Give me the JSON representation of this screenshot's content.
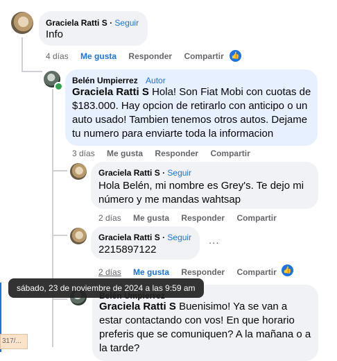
{
  "comments": [
    {
      "author": "Graciela Ratti S",
      "follow": "Seguir",
      "text": "Info",
      "time": "4 días",
      "like": "Me gusta",
      "reply": "Responder",
      "share": "Compartir"
    },
    {
      "author": "Belén Umpierrez",
      "badge": "Autor",
      "tag": "Graciela Ratti S",
      "text": "Hola! Son Fiat Mobi con cuotas de $183.000. Hay opcion de retirarlo con anticipo o un auto usado! Tambien tenemos otros autos. Dejame tu numero para enviarte toda la informacion",
      "time": "3 días",
      "like": "Me gusta",
      "reply": "Responder",
      "share": "Compartir"
    },
    {
      "author": "Graciela Ratti S",
      "follow": "Seguir",
      "text": "Hola Belén, mi nombre es Grey's. Te dejo mi número y me mandas wahtsap",
      "time": "2 días",
      "like": "Me gusta",
      "reply": "Responder",
      "share": "Compartir"
    },
    {
      "author": "Graciela Ratti S",
      "follow": "Seguir",
      "text": "2215897122",
      "time": "2 días",
      "like": "Me gusta",
      "reply": "Responder",
      "share": "Compartir",
      "more": "..."
    },
    {
      "author": "Belén Umpierrez",
      "tag": "Graciela Ratti S",
      "text": "Buenisimo! Ya se van a estar contactando con vos! En que horario preferis que se comuniquen? A la mañana o a la tarde?"
    }
  ],
  "reactions": {
    "icon": "thumbs-up-icon",
    "glyph": "👍",
    "color": "#1b74e4"
  },
  "tooltip": "sábado, 23 de noviembre de 2024 a las 9:59 am",
  "edge_snippet": "317/..."
}
